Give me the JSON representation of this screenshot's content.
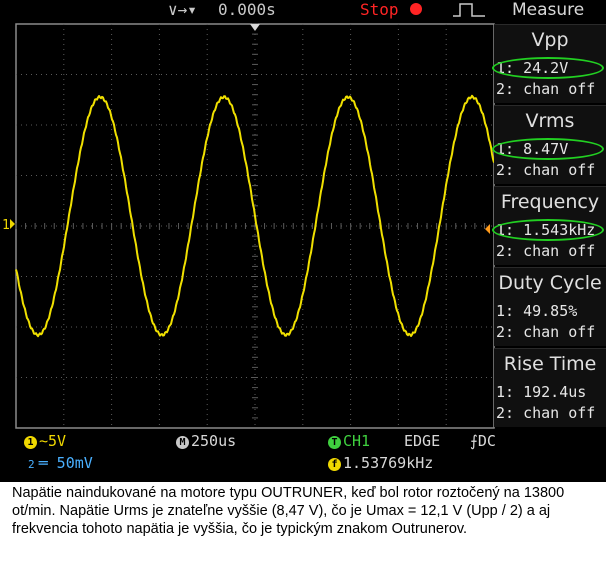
{
  "topbar": {
    "trigger_icons": "∨→▾",
    "time_offset": "0.000s",
    "run_state": "Stop",
    "panel_title": "Measure"
  },
  "trace": {
    "color": "#f0e000",
    "grid_color": "#5a5a5a",
    "marker_label": "1"
  },
  "measurements": [
    {
      "title": "Vpp",
      "ch1": "1: 24.2V",
      "ch2": "2: chan off",
      "highlighted": true
    },
    {
      "title": "Vrms",
      "ch1": "1: 8.47V",
      "ch2": "2: chan off",
      "highlighted": true
    },
    {
      "title": "Frequency",
      "ch1": "1: 1.543kHz",
      "ch2": "2: chan off",
      "highlighted": true
    },
    {
      "title": "Duty Cycle",
      "ch1": "1: 49.85%",
      "ch2": "2: chan off",
      "highlighted": false
    },
    {
      "title": "Rise Time",
      "ch1": "1: 192.4us",
      "ch2": "2: chan off",
      "highlighted": false
    }
  ],
  "status": {
    "ch1_badge": "1",
    "ch1_scale": "∼5V",
    "ch2_badge": "2",
    "ch2_scale": "═ 50mV",
    "timebase_badge": "M",
    "timebase": "250us",
    "trigger_badge": "T",
    "trigger_source": "CH1",
    "trigger_type": "EDGE",
    "trigger_coupling": "⨍DC",
    "freq_badge": "f",
    "trigger_freq": "1.53769kHz"
  },
  "caption": "Napätie naindukované  na motore typu OUTRUNER, keď bol rotor roztočený na 13800 ot/min. Napätie Urms je znateľne vyššie (8,47 V), čo je Umax = 12,1 V (Upp / 2) a aj frekvencia tohoto napätia je vyššia, čo je typickým znakom Outrunerov."
}
